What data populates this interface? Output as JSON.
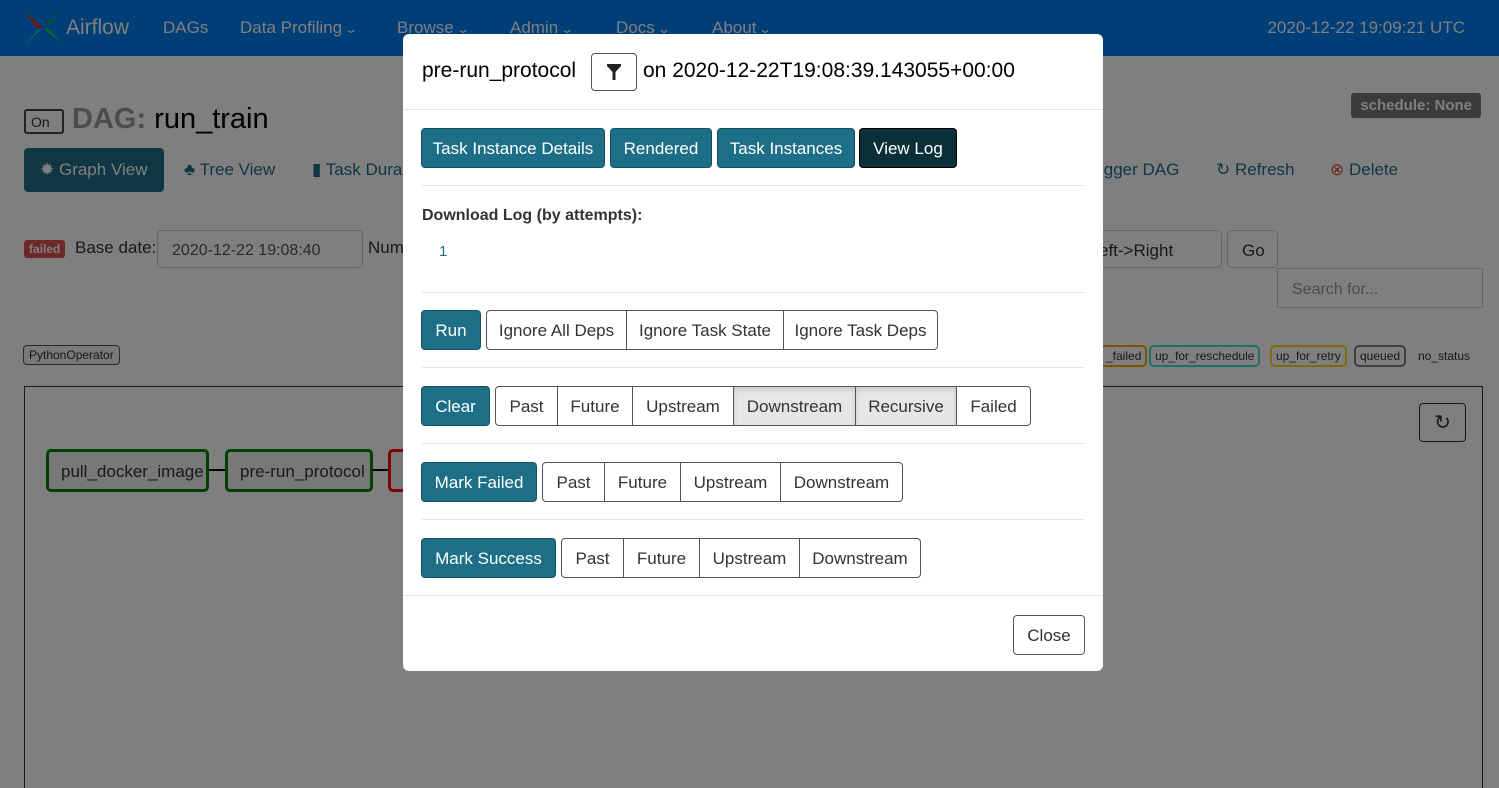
{
  "navbar": {
    "brand": "Airflow",
    "items": [
      {
        "label": "DAGs",
        "has_dropdown": false
      },
      {
        "label": "Data Profiling",
        "has_dropdown": true
      },
      {
        "label": "Browse",
        "has_dropdown": true
      },
      {
        "label": "Admin",
        "has_dropdown": true
      },
      {
        "label": "Docs",
        "has_dropdown": true
      },
      {
        "label": "About",
        "has_dropdown": true
      }
    ],
    "time": "2020-12-22 19:09:21 UTC"
  },
  "dag": {
    "toggle_label": "On",
    "title_prefix": "DAG:",
    "title": "run_train",
    "schedule": "schedule: None"
  },
  "views": {
    "graph_view": "Graph View",
    "tree_view": "Tree View",
    "task_duration": "Task Dura",
    "trigger_dag": "igger DAG",
    "refresh": "Refresh",
    "delete": "Delete"
  },
  "controls": {
    "state_badge": "failed",
    "base_date_label": "Base date:",
    "base_date_value": "2020-12-22 19:08:40",
    "num_label": "Num",
    "orientation_value": "eft->Right",
    "go_label": "Go",
    "search_placeholder": "Search for..."
  },
  "legend": {
    "operator": "PythonOperator",
    "states": [
      "_failed",
      "up_for_reschedule",
      "up_for_retry",
      "queued"
    ],
    "no_status": "no_status",
    "state_colors": {
      "_failed": "#ffa500",
      "up_for_reschedule": "#40e0d0",
      "up_for_retry": "#ffd700",
      "queued": "#808080"
    }
  },
  "graph": {
    "nodes": [
      "pull_docker_image",
      "pre-run_protocol"
    ],
    "node_border_success": "#008000",
    "node_border_failed": "#ff0000"
  },
  "modal": {
    "task_id": "pre-run_protocol",
    "on_label": "on 2020-12-22T19:08:39.143055+00:00",
    "tabs": [
      "Task Instance Details",
      "Rendered",
      "Task Instances",
      "View Log"
    ],
    "download_log_label": "Download Log (by attempts):",
    "attempts": [
      "1"
    ],
    "run": {
      "label": "Run",
      "options": [
        "Ignore All Deps",
        "Ignore Task State",
        "Ignore Task Deps"
      ]
    },
    "clear": {
      "label": "Clear",
      "options": [
        "Past",
        "Future",
        "Upstream",
        "Downstream",
        "Recursive",
        "Failed"
      ]
    },
    "mark_failed": {
      "label": "Mark Failed",
      "options": [
        "Past",
        "Future",
        "Upstream",
        "Downstream"
      ]
    },
    "mark_success": {
      "label": "Mark Success",
      "options": [
        "Past",
        "Future",
        "Upstream",
        "Downstream"
      ]
    },
    "close_label": "Close"
  },
  "colors": {
    "navbar": "#017cee",
    "primary": "#1c6f86",
    "dark": "#0b2f39",
    "failed": "#d9534f"
  }
}
